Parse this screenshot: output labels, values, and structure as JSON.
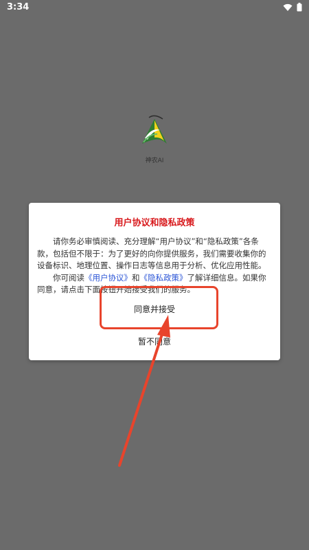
{
  "status_bar": {
    "time": "3:34",
    "wifi_icon": "wifi-icon",
    "battery_icon": "battery-icon"
  },
  "splash": {
    "logo_icon": "app-logo",
    "app_name": "神农AI"
  },
  "dialog": {
    "title": "用户协议和隐私政策",
    "paragraph1": "请你务必审慎阅读、充分理解“用户协议”和“隐私政策”各条款，包括但不限于：为了更好的向你提供服务，我们需要收集你的设备标识、地理位置、操作日志等信息用于分析、优化应用性能。",
    "paragraph2_prefix": "你可阅读",
    "link_user_agreement": "《用户协议》",
    "paragraph2_and": "和",
    "link_privacy_policy": "《隐私政策》",
    "paragraph2_suffix": "了解详细信息。如果你同意，请点击下面按钮开始接受我们的服务。",
    "accept_label": "同意并接受",
    "decline_label": "暂不同意"
  },
  "annotation": {
    "highlight_color": "#e8442c"
  },
  "colors": {
    "overlay": "#6b6b6b",
    "title_red": "#d8191c",
    "link_blue": "#2a54d6"
  }
}
